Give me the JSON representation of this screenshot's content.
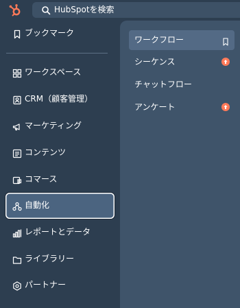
{
  "header": {
    "logo": "hubspot-logo",
    "search_placeholder": "HubSpotを検索"
  },
  "sidebar": {
    "items": [
      {
        "label": "ブックマーク",
        "icon": "bookmark-icon"
      },
      {
        "label": "ワークスペース",
        "icon": "grid-icon"
      },
      {
        "label": "CRM（顧客管理）",
        "icon": "contact-card-icon"
      },
      {
        "label": "マーケティング",
        "icon": "megaphone-icon"
      },
      {
        "label": "コンテンツ",
        "icon": "content-icon"
      },
      {
        "label": "コマース",
        "icon": "commerce-icon"
      },
      {
        "label": "自動化",
        "icon": "automation-icon",
        "active": true
      },
      {
        "label": "レポートとデータ",
        "icon": "bar-chart-icon"
      },
      {
        "label": "ライブラリー",
        "icon": "folder-icon"
      },
      {
        "label": "パートナー",
        "icon": "partner-icon"
      }
    ]
  },
  "submenu": {
    "items": [
      {
        "label": "ワークフロー",
        "selected": true,
        "trailing": "bookmark-icon"
      },
      {
        "label": "シーケンス",
        "trailing": "upgrade-icon"
      },
      {
        "label": "チャットフロー",
        "trailing": ""
      },
      {
        "label": "アンケート",
        "trailing": "upgrade-icon"
      }
    ]
  },
  "colors": {
    "sidebar_bg": "#2d3e50",
    "panel_bg": "#3f546a",
    "active_bg": "#4b6480",
    "selected_bg": "#536a85",
    "upgrade": "#ff7a59",
    "logo": "#ff7a59"
  }
}
